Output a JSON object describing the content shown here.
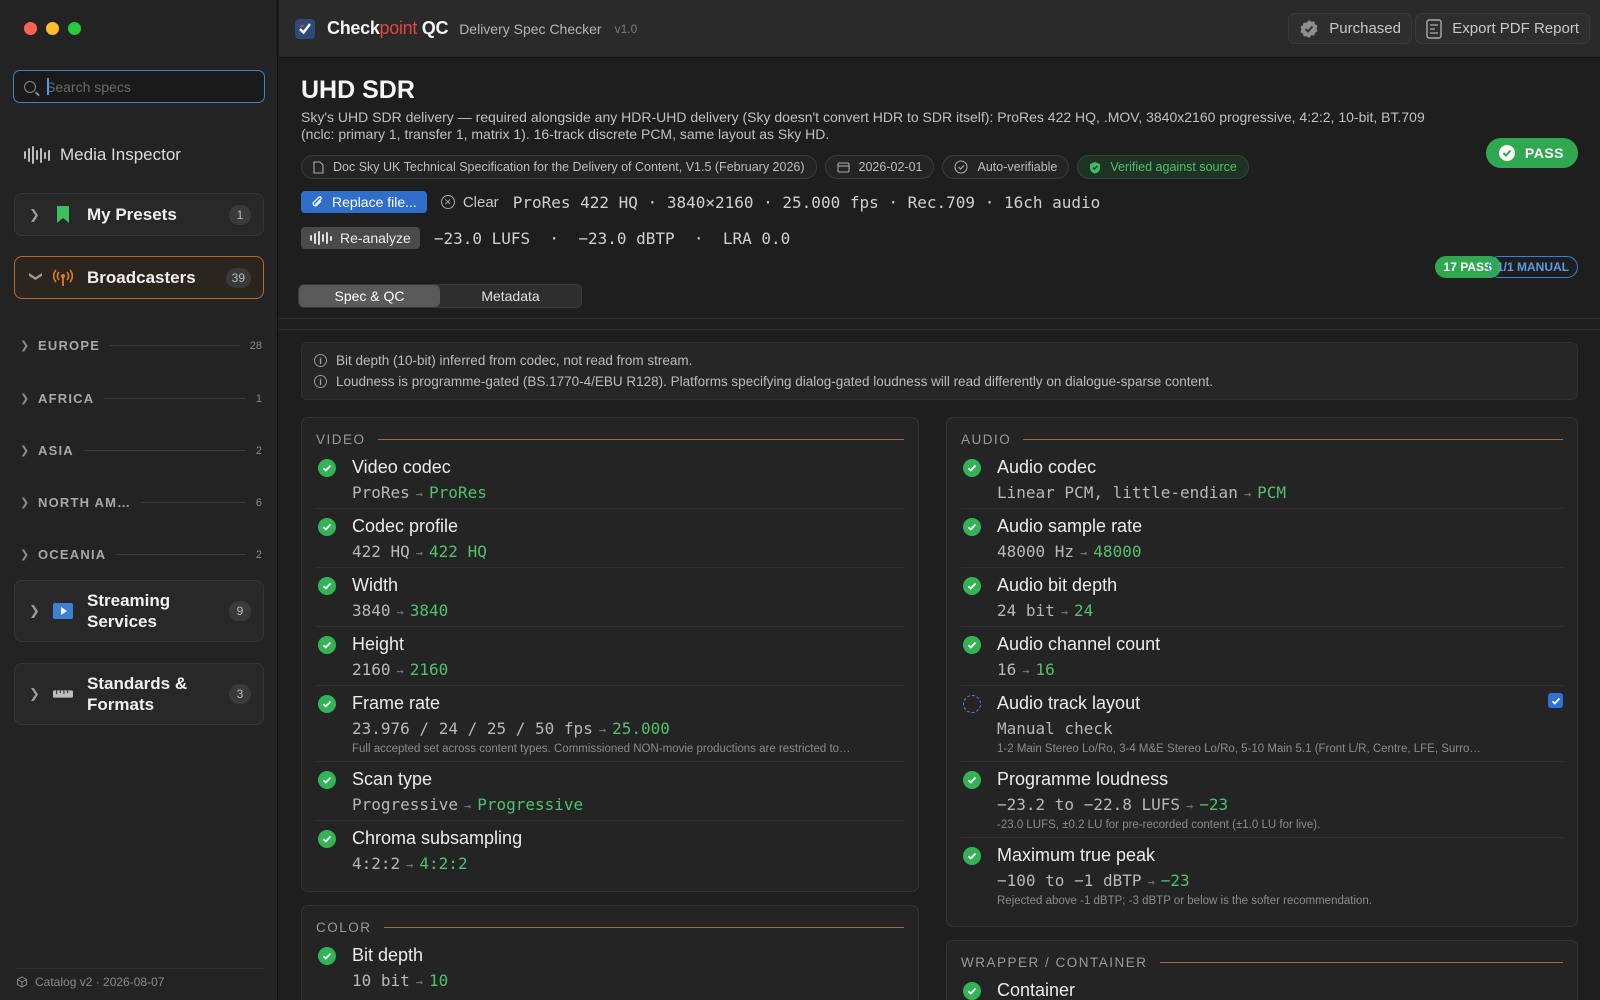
{
  "window": {
    "traffic_colors": [
      "#ff5f57",
      "#febc2e",
      "#28c840"
    ]
  },
  "sidebar": {
    "search_placeholder": "Search specs",
    "media_inspector": "Media Inspector",
    "my_presets": {
      "label": "My Presets",
      "count": "1"
    },
    "broadcasters": {
      "label": "Broadcasters",
      "count": "39"
    },
    "regions": [
      {
        "label": "EUROPE",
        "count": "28"
      },
      {
        "label": "AFRICA",
        "count": "1"
      },
      {
        "label": "ASIA",
        "count": "2"
      },
      {
        "label": "NORTH AM…",
        "count": "6"
      },
      {
        "label": "OCEANIA",
        "count": "2"
      }
    ],
    "streaming": {
      "label": "Streaming Services",
      "count": "9"
    },
    "standards": {
      "label": "Standards & Formats",
      "count": "3"
    },
    "catalog": "Catalog v2 · 2026-08-07"
  },
  "titlebar": {
    "brand_a": "Check",
    "brand_b": "point",
    "brand_c": " QC",
    "subtitle": "Delivery Spec Checker",
    "version": "v1.0",
    "purchased": "Purchased",
    "export": "Export PDF Report"
  },
  "spec": {
    "title": "UHD SDR",
    "description": "Sky's UHD SDR delivery — required alongside any HDR-UHD delivery (Sky doesn't convert HDR to SDR itself): ProRes 422 HQ, .MOV, 3840x2160 progressive, 4:2:2, 10-bit, BT.709 (nclc: primary 1, transfer 1, matrix 1). 16-track discrete PCM, same layout as Sky HD.",
    "status": "PASS",
    "tags": {
      "doc": "Doc Sky UK Technical Specification for the Delivery of Content, V1.5 (February 2026)",
      "date": "2026-02-01",
      "auto": "Auto-verifiable",
      "verified": "Verified against source"
    },
    "replace_btn": "Replace file...",
    "clear_btn": "Clear",
    "file_summary": "ProRes 422 HQ · 3840×2160 · 25.000 fps · Rec.709 · 16ch audio",
    "reanalyze_btn": "Re-analyze",
    "loudness_summary": "−23.0 LUFS  ·  −23.0 dBTP  ·  LRA 0.0",
    "pass_count": "17 PASS",
    "manual_count": "1/1 MANUAL"
  },
  "tabs": [
    "Spec & QC",
    "Metadata"
  ],
  "notes": [
    "Bit depth (10-bit) inferred from codec, not read from stream.",
    "Loudness is programme-gated (BS.1770-4/EBU R128). Platforms specifying dialog-gated loudness will read differently on dialogue-sparse content."
  ],
  "video": {
    "title": "VIDEO",
    "items": [
      {
        "name": "Video codec",
        "actual": "ProRes",
        "expected": "ProRes"
      },
      {
        "name": "Codec profile",
        "actual": "422 HQ",
        "expected": "422 HQ"
      },
      {
        "name": "Width",
        "actual": "3840",
        "expected": "3840"
      },
      {
        "name": "Height",
        "actual": "2160",
        "expected": "2160"
      },
      {
        "name": "Frame rate",
        "actual": "23.976 / 24 / 25 / 50 fps",
        "expected": "25.000",
        "note": "Full accepted set across content types. Commissioned NON-movie productions are restricted to…"
      },
      {
        "name": "Scan type",
        "actual": "Progressive",
        "expected": "Progressive"
      },
      {
        "name": "Chroma subsampling",
        "actual": "4:2:2",
        "expected": "4:2:2"
      }
    ]
  },
  "audio": {
    "title": "AUDIO",
    "items": [
      {
        "name": "Audio codec",
        "actual": "Linear PCM, little-endian",
        "expected": "PCM"
      },
      {
        "name": "Audio sample rate",
        "actual": "48000 Hz",
        "expected": "48000"
      },
      {
        "name": "Audio bit depth",
        "actual": "24 bit",
        "expected": "24"
      },
      {
        "name": "Audio channel count",
        "actual": "16",
        "expected": "16"
      },
      {
        "name": "Audio track layout",
        "actual": "Manual check",
        "note": "1-2 Main Stereo Lo/Ro, 3-4 M&E Stereo Lo/Ro, 5-10 Main 5.1 (Front L/R, Centre, LFE, Surro…"
      },
      {
        "name": "Programme loudness",
        "actual": "−23.2 to −22.8 LUFS",
        "expected": "−23",
        "note": "-23.0 LUFS, ±0.2 LU for pre-recorded content (±1.0 LU for live)."
      },
      {
        "name": "Maximum true peak",
        "actual": "−100 to −1 dBTP",
        "expected": "−23",
        "note": "Rejected above -1 dBTP; -3 dBTP or below is the softer recommendation."
      }
    ]
  },
  "color": {
    "title": "COLOR",
    "items": [
      {
        "name": "Bit depth",
        "actual": "10 bit",
        "expected": "10"
      }
    ]
  },
  "wrapper": {
    "title": "WRAPPER / CONTAINER",
    "items": [
      {
        "name": "Container"
      }
    ]
  },
  "colors": {
    "accent_blue": "#2f6fc9",
    "pass_green": "#2fa84f",
    "ok_text": "#4fc26b",
    "section_line": "#a86a33",
    "broadcaster_orange": "#e07b2a"
  }
}
